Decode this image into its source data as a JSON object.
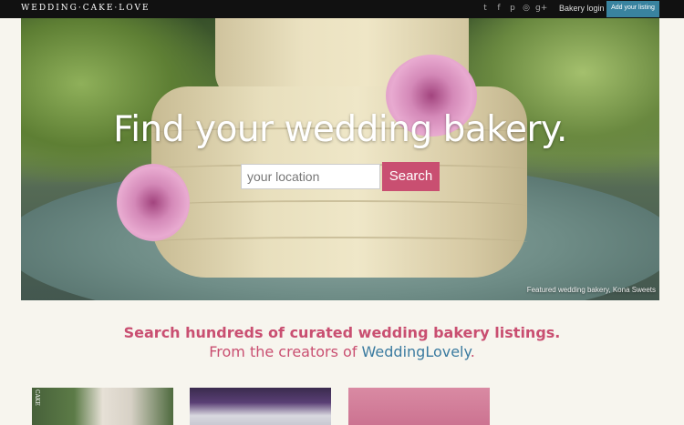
{
  "header": {
    "logo": "WEDDING·CAKE·LOVE",
    "social_icons": [
      "twitter-icon",
      "facebook-icon",
      "pinterest-icon",
      "instagram-icon",
      "google-plus-icon"
    ],
    "social_glyphs": [
      "t",
      "f",
      "p",
      "◎",
      "g+"
    ],
    "login_label": "Bakery login",
    "add_listing_label": "Add your listing"
  },
  "hero": {
    "headline": "Find your wedding bakery.",
    "search_placeholder": "your location",
    "search_button": "Search",
    "caption": "Featured wedding bakery, Kona Sweets"
  },
  "tagline": {
    "line1": "Search hundreds of curated wedding bakery listings.",
    "line2_prefix": "From the creators of ",
    "line2_brand": "WeddingLovely",
    "line2_suffix": "."
  },
  "thumbnails": [
    {
      "label": "CAKE"
    },
    {
      "label": ""
    },
    {
      "label": ""
    }
  ],
  "colors": {
    "accent_pink": "#c94f71",
    "link_blue": "#3b7ba0",
    "topbar": "#111111",
    "add_button": "#39839f"
  }
}
